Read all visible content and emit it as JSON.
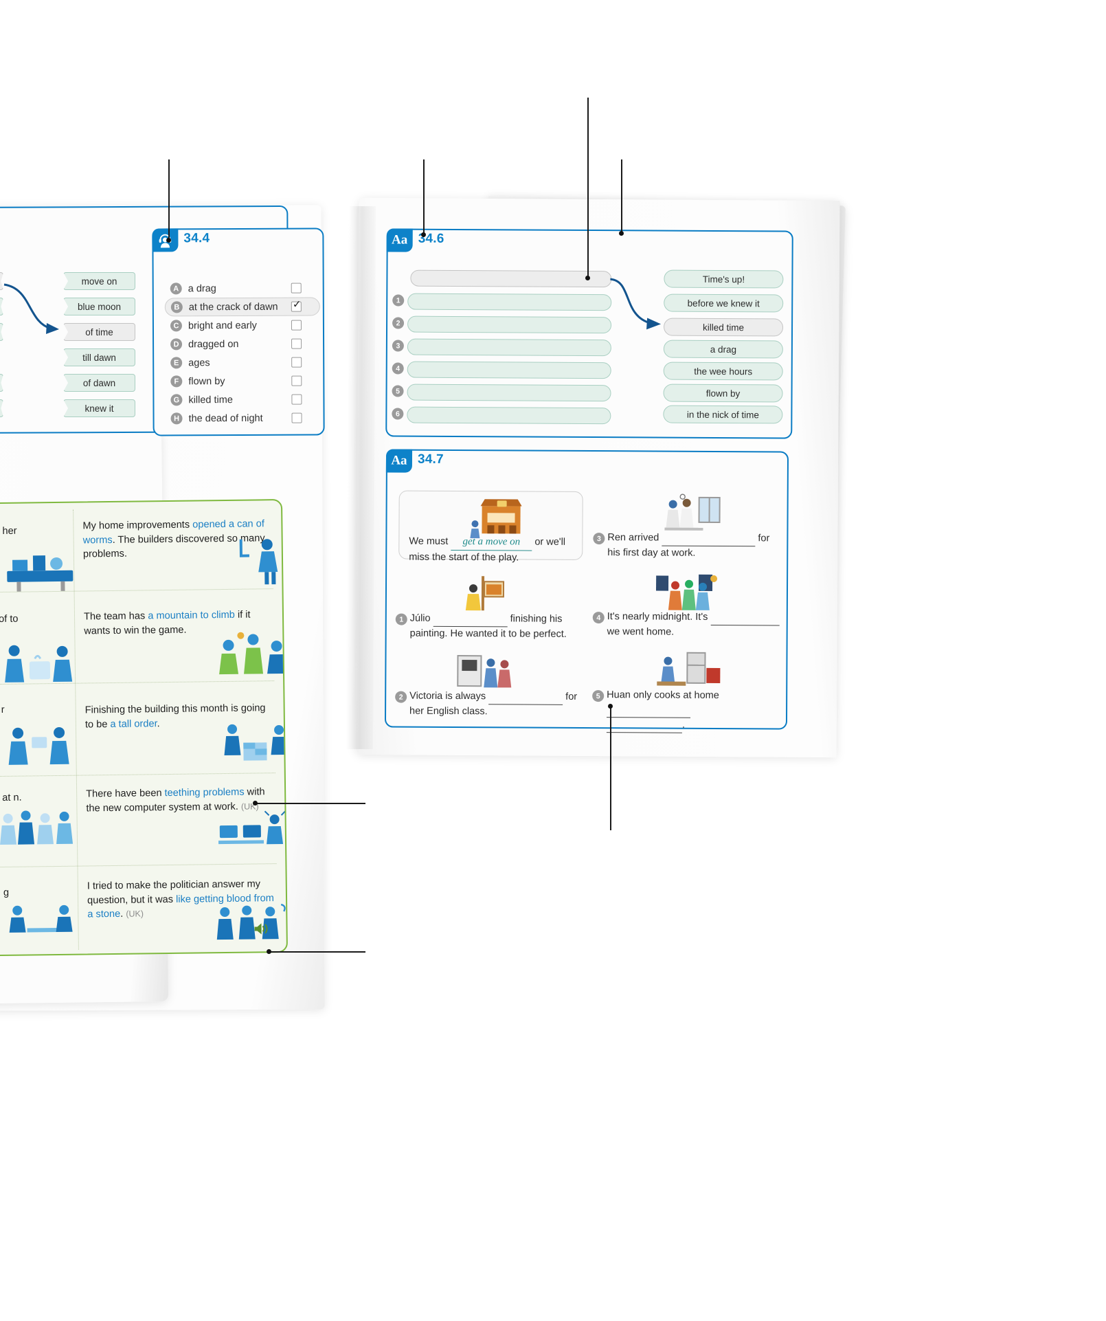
{
  "book": {
    "title_hidden": "",
    "left_page": {
      "exercise_34_3": {
        "left_tags": [
          "",
          "",
          "",
          "",
          ""
        ],
        "right_tags": [
          "move on",
          "blue moon",
          "of time",
          "till dawn",
          "of dawn",
          "knew it"
        ],
        "selected_right_tag": "of time"
      },
      "exercise_34_4": {
        "number": "34.4",
        "icon": "headphones-person-icon",
        "options": [
          {
            "letter": "A",
            "text": "a drag",
            "checked": false
          },
          {
            "letter": "B",
            "text": "at the crack of dawn",
            "checked": true
          },
          {
            "letter": "C",
            "text": "bright and early",
            "checked": false
          },
          {
            "letter": "D",
            "text": "dragged on",
            "checked": false
          },
          {
            "letter": "E",
            "text": "ages",
            "checked": false
          },
          {
            "letter": "F",
            "text": "flown by",
            "checked": false
          },
          {
            "letter": "G",
            "text": "killed time",
            "checked": false
          },
          {
            "letter": "H",
            "text": "the dead of night",
            "checked": false
          }
        ]
      },
      "idiom_panel": {
        "audio_icon": "speaker-icon",
        "rows": [
          {
            "left_text": "",
            "left_suffix": "her",
            "text_before": "My home improvements ",
            "highlight": "opened a can of worms",
            "text_after": ". The builders discovered so many problems.",
            "uk": "",
            "left_art": "workshop-tools-icon",
            "right_art": "plumber-pipes-icon"
          },
          {
            "left_text": "",
            "left_suffix": "of to",
            "text_before": "The team has ",
            "highlight": "a mountain to climb",
            "text_after": " if it wants to win the game.",
            "uk": "",
            "left_art": "kitchen-cooks-icon",
            "right_art": "sports-team-icon"
          },
          {
            "left_text": "",
            "left_suffix": "r",
            "text_before": "Finishing the building this month is going to be ",
            "highlight": "a tall order",
            "text_after": ".",
            "uk": "",
            "left_art": "award-handover-icon",
            "right_art": "bricklayers-icon"
          },
          {
            "left_text": "",
            "left_suffix": "at n.",
            "text_before": "There have been ",
            "highlight": "teething problems",
            "text_after": " with the new computer system at work.",
            "uk": "(UK)",
            "left_art": "crowd-people-icon",
            "right_art": "office-computers-icon"
          },
          {
            "left_text": "",
            "left_suffix": "g",
            "text_before": "I tried to make the politician answer my question, but it was ",
            "highlight": "like getting blood from a stone",
            "text_after": ".",
            "uk": "(UK)",
            "left_art": "desk-meeting-icon",
            "right_art": "interview-people-icon"
          }
        ]
      }
    },
    "right_page": {
      "exercise_34_6": {
        "number": "34.6",
        "icon": "aa-icon",
        "example_blank": "",
        "answer_blanks": [
          "",
          "",
          "",
          "",
          "",
          ""
        ],
        "answer_numbers": [
          "1",
          "2",
          "3",
          "4",
          "5",
          "6"
        ],
        "word_bank": [
          "Time's up!",
          "before we knew it",
          "killed time",
          "a drag",
          "the wee hours",
          "flown by",
          "in the nick of time"
        ],
        "word_bank_selected": "killed time"
      },
      "exercise_34_7": {
        "number": "34.7",
        "icon": "aa-icon",
        "example": {
          "art": "theatre-stage-icon",
          "before": "We must",
          "answer": "get a move on",
          "after": "or we'll miss the start of the play."
        },
        "items": [
          {
            "number": "1",
            "art": "painter-easel-icon",
            "before": "Júlio",
            "blank": "",
            "after": "finishing his painting. He wanted it to be perfect."
          },
          {
            "number": "2",
            "art": "classroom-entry-icon",
            "before": "Victoria is always",
            "blank": "",
            "after": "for her English class."
          },
          {
            "number": "3",
            "art": "office-morning-icon",
            "before": "Ren arrived",
            "blank": "",
            "after": "for his first day at work."
          },
          {
            "number": "4",
            "art": "night-party-icon",
            "before": "It's nearly midnight. It's",
            "blank": "",
            "after": "we went home."
          },
          {
            "number": "5",
            "art": "home-kitchen-icon",
            "before": "Huan only cooks at home",
            "blank": "",
            "after": "."
          }
        ]
      }
    }
  },
  "annotations": {
    "leaders": [
      {
        "name": "leader-to-34-4-badge"
      },
      {
        "name": "leader-to-34-6-badge"
      },
      {
        "name": "leader-to-34-6-example-blank"
      },
      {
        "name": "leader-to-34-6-card-border"
      },
      {
        "name": "leader-to-teething-uk-label"
      },
      {
        "name": "leader-to-audio-speaker-icon"
      },
      {
        "name": "leader-to-34-7-item-5"
      }
    ]
  },
  "colors": {
    "brand_blue": "#0d82c9",
    "tag_green_fill": "#e3f0ea",
    "tag_green_border": "#a9cfc2",
    "panel_green_border": "#7fb93f",
    "answer_teal": "#1d8a8a",
    "highlight_blue": "#1b7fc4"
  }
}
